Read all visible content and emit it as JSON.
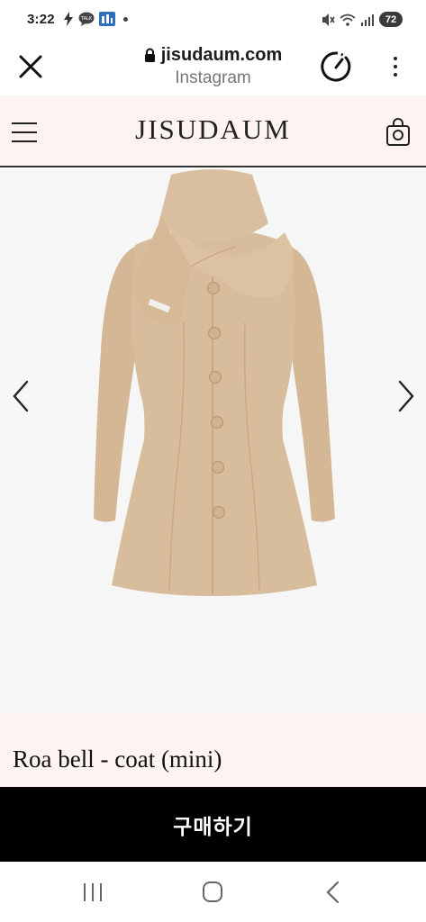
{
  "status": {
    "time": "3:22",
    "notif_talk": "TALK",
    "battery": "72"
  },
  "browser": {
    "domain": "jisudaum.com",
    "source": "Instagram"
  },
  "site": {
    "logo": "JISUDAUM"
  },
  "product": {
    "title": "Roa bell - coat (mini)",
    "image_icon": "coat-product-image"
  },
  "buy": {
    "label": "구매하기"
  },
  "icons": {
    "close": "close-icon",
    "lock": "lock-icon",
    "speed": "speedometer-icon",
    "more": "more-vert-icon",
    "menu": "hamburger-menu-icon",
    "cart": "shopping-bag-icon",
    "prev": "chevron-left-icon",
    "next": "chevron-right-icon"
  },
  "colors": {
    "header_bg": "#fdf4f1",
    "buy_bg": "#000000",
    "coat": "#d8bd9c"
  }
}
